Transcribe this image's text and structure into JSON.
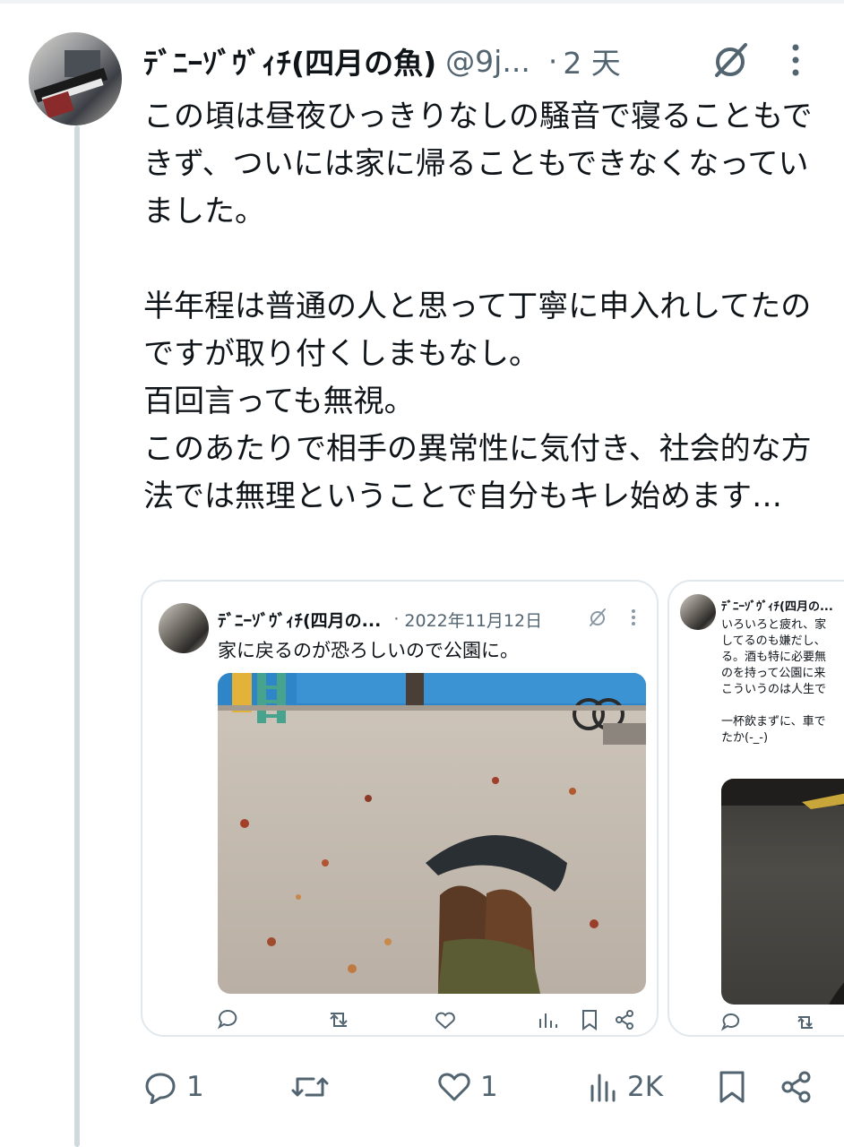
{
  "author": {
    "name": "ﾃﾞﾆｰｿﾞｳﾞｨﾁ(四月の魚)",
    "handle": "@9j...",
    "separator": "·",
    "time": "2 天"
  },
  "icons": [
    "grok-icon",
    "more-icon",
    "reply-icon",
    "repost-icon",
    "like-icon",
    "views-icon",
    "bookmark-icon",
    "share-icon"
  ],
  "tweet": {
    "text": "この頃は昼夜ひっきりなしの騒音で寝ることもできず、ついには家に帰ることもできなくなっていました。\n\n半年程は普通の人と思って丁寧に申入れしてたのですが取り付くしまもなし。\n百回言っても無視。\nこのあたりで相手の異常性に気付き、社会的な方法では無理ということで自分もキレ始めます…"
  },
  "quoted_cards": [
    {
      "name": "ﾃﾞﾆｰｿﾞｳﾞｨﾁ(四月の...",
      "separator": "·",
      "date": "2022年11月12日",
      "text": "家に戻るのが恐ろしいので公園に。"
    },
    {
      "name": "ﾃﾞﾆｰｿﾞｳﾞｨﾁ(四月の...",
      "text": "いろいろと疲れ、家\nしてるのも嫌だし、\nる。酒も特に必要無\nのを持って公園に来\nこういうのは人生で\n\n一杯飲まずに、車で\nたか(-_-)"
    }
  ],
  "actions": {
    "replies": "1",
    "reposts": "",
    "likes": "1",
    "views": "2K"
  },
  "colors": {
    "text": "#0f1419",
    "secondary": "#536471",
    "border": "#e1e8ed",
    "thread_line": "#cfd9de"
  }
}
